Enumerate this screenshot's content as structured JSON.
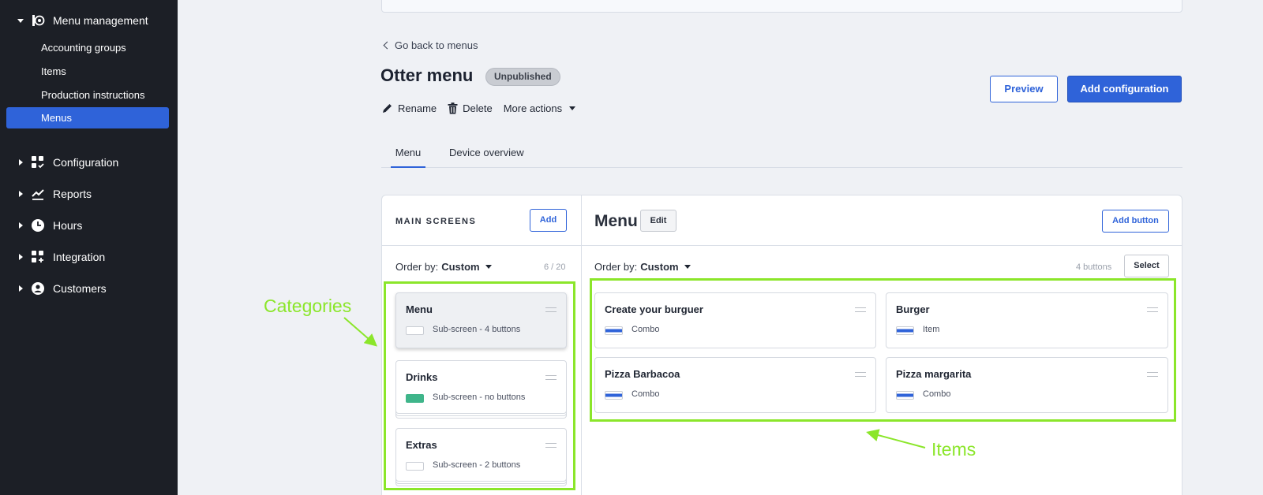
{
  "sidebar": {
    "menu_management": "Menu management",
    "sub_items": [
      "Accounting groups",
      "Items",
      "Production instructions",
      "Menus"
    ],
    "configuration": "Configuration",
    "reports": "Reports",
    "hours": "Hours",
    "integration": "Integration",
    "customers": "Customers"
  },
  "main": {
    "back_label": "Go back to menus",
    "title": "Otter menu",
    "status_badge": "Unpublished",
    "rename": "Rename",
    "delete": "Delete",
    "more_actions": "More actions",
    "preview": "Preview",
    "add_configuration": "Add configuration",
    "tabs": [
      "Menu",
      "Device overview"
    ]
  },
  "screens": {
    "title": "MAIN SCREENS",
    "add": "Add",
    "order_by": "Order by:",
    "order_value": "Custom",
    "count": "6 / 20",
    "cards": [
      {
        "name": "Menu",
        "sub": "Sub-screen - 4 buttons",
        "swatch": "#ffffff"
      },
      {
        "name": "Drinks",
        "sub": "Sub-screen - no buttons",
        "swatch": "#3fb58a"
      },
      {
        "name": "Extras",
        "sub": "Sub-screen - 2 buttons",
        "swatch": "#ffffff"
      }
    ]
  },
  "menu_panel": {
    "title": "Menu",
    "edit": "Edit",
    "add_button": "Add button",
    "order_by": "Order by:",
    "order_value": "Custom",
    "count": "4 buttons",
    "select": "Select",
    "cards": [
      {
        "name": "Create your burguer",
        "sub": "Combo"
      },
      {
        "name": "Burger",
        "sub": "Item"
      },
      {
        "name": "Pizza Barbacoa",
        "sub": "Combo"
      },
      {
        "name": "Pizza margarita",
        "sub": "Combo"
      }
    ]
  },
  "annotations": {
    "categories": "Categories",
    "items": "Items",
    "color": "#8be62a"
  },
  "colors": {
    "accent": "#2f63d9",
    "sidebar": "#1c1f26"
  }
}
